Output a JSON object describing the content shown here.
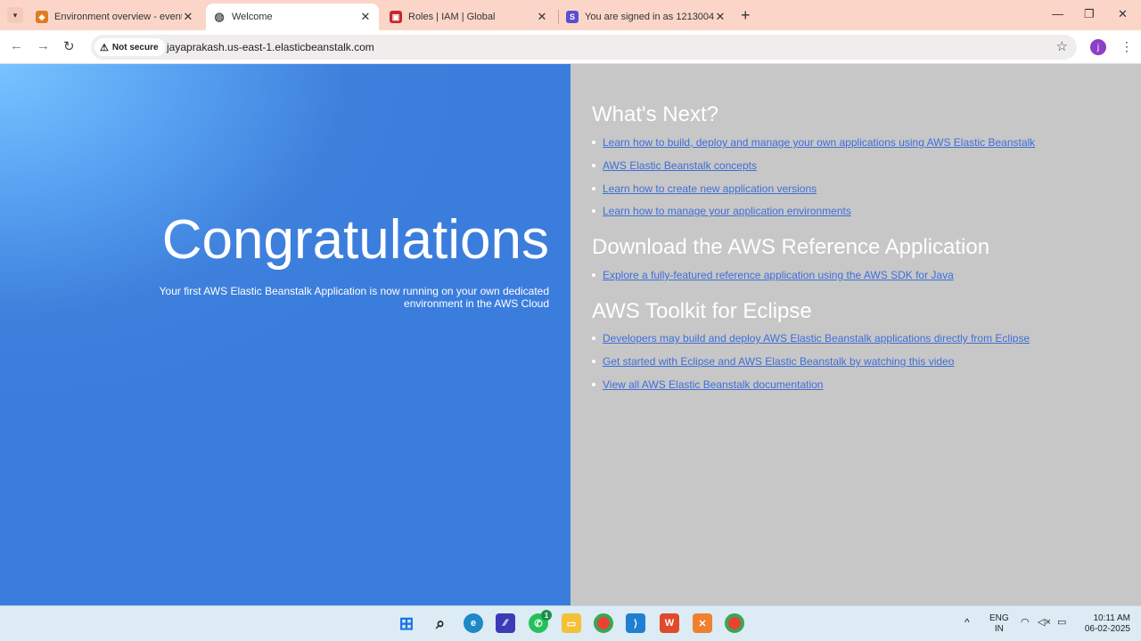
{
  "browser": {
    "tabs": [
      {
        "title": "Environment overview - events",
        "favicon": "aws-favicon",
        "color": "#e07b1f"
      },
      {
        "title": "Welcome",
        "favicon": "globe-favicon",
        "color": "#555555"
      },
      {
        "title": "Roles | IAM | Global",
        "favicon": "iam-favicon",
        "color": "#c7272d"
      },
      {
        "title": "You are signed in as 1213004",
        "favicon": "s-favicon",
        "color": "#5b4fcf"
      }
    ],
    "security_label": "Not secure",
    "url": "jayaprakash.us-east-1.elasticbeanstalk.com",
    "profile_initial": "j"
  },
  "hero": {
    "title": "Congratulations",
    "subtitle": "Your first AWS Elastic Beanstalk Application is now running on your own dedicated environment in the AWS Cloud"
  },
  "sections": [
    {
      "heading": "What's Next?",
      "links": [
        "Learn how to build, deploy and manage your own applications using AWS Elastic Beanstalk",
        "AWS Elastic Beanstalk concepts",
        "Learn how to create new application versions",
        "Learn how to manage your application environments"
      ]
    },
    {
      "heading": "Download the AWS Reference Application",
      "links": [
        "Explore a fully-featured reference application using the AWS SDK for Java"
      ]
    },
    {
      "heading": "AWS Toolkit for Eclipse",
      "links": [
        "Developers may build and deploy AWS Elastic Beanstalk applications directly from Eclipse",
        "Get started with Eclipse and AWS Elastic Beanstalk by watching this video",
        "View all AWS Elastic Beanstalk documentation"
      ]
    }
  ],
  "taskbar": {
    "lang_top": "ENG",
    "lang_bottom": "IN",
    "time": "10:11 AM",
    "date": "06-02-2025",
    "whatsapp_badge": "1"
  },
  "colors": {
    "link": "#3f6ed8",
    "left_bg": "#3b7ddc",
    "right_bg": "#c7c7c7",
    "tabstrip": "#fbd6c8"
  }
}
